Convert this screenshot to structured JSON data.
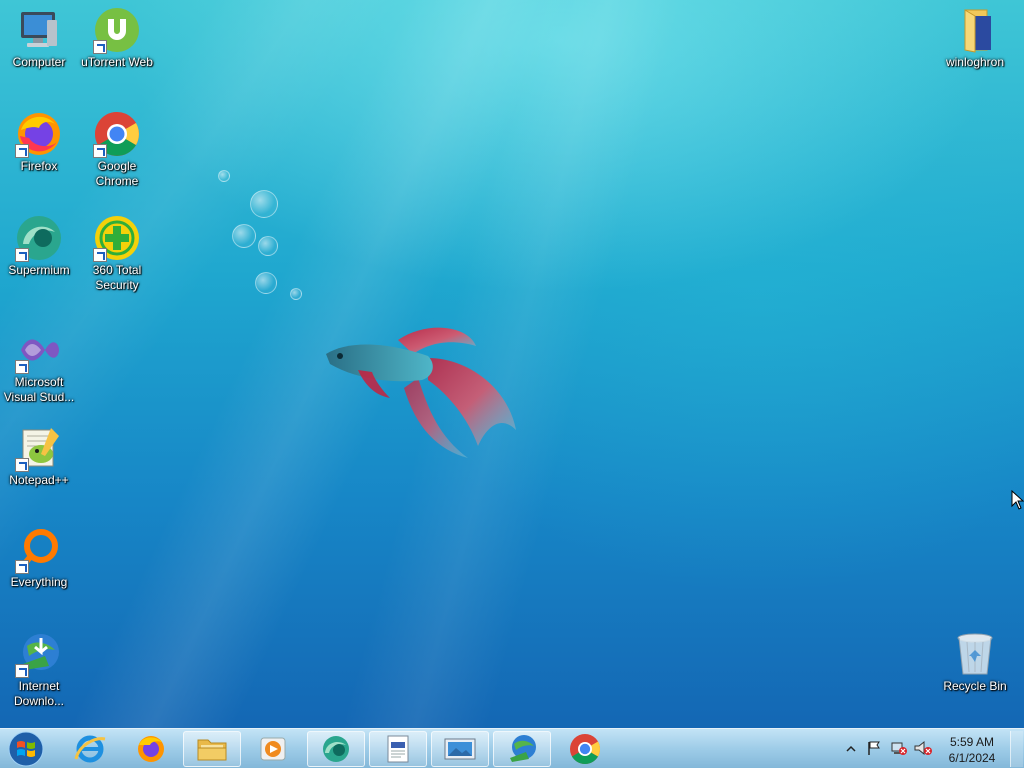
{
  "desktop": {
    "icons": [
      {
        "label": "Computer",
        "icon": "computer-icon"
      },
      {
        "label": "uTorrent Web",
        "icon": "utorrent-icon"
      },
      {
        "label": "Firefox",
        "icon": "firefox-icon"
      },
      {
        "label": "Google Chrome",
        "icon": "chrome-icon"
      },
      {
        "label": "Supermium",
        "icon": "supermium-icon"
      },
      {
        "label": "360 Total Security",
        "icon": "360-security-icon"
      },
      {
        "label": "Microsoft Visual Stud...",
        "icon": "visual-studio-icon"
      },
      {
        "label": "Notepad++",
        "icon": "notepadpp-icon"
      },
      {
        "label": "Everything",
        "icon": "everything-icon"
      },
      {
        "label": "Internet Downlo...",
        "icon": "idm-icon"
      },
      {
        "label": "winloghron",
        "icon": "folder-icon"
      },
      {
        "label": "Recycle Bin",
        "icon": "recycle-bin-icon"
      }
    ]
  },
  "taskbar": {
    "start": "windows-start-icon",
    "items": [
      {
        "name": "internet-explorer",
        "icon": "ie-icon"
      },
      {
        "name": "firefox",
        "icon": "firefox-icon"
      },
      {
        "name": "file-explorer",
        "icon": "folder-icon"
      },
      {
        "name": "media-player",
        "icon": "media-player-icon"
      },
      {
        "name": "supermium",
        "icon": "supermium-icon"
      },
      {
        "name": "document-viewer",
        "icon": "document-icon"
      },
      {
        "name": "image-viewer",
        "icon": "picture-icon"
      },
      {
        "name": "internet-download-manager",
        "icon": "idm-icon"
      },
      {
        "name": "google-chrome",
        "icon": "chrome-icon"
      }
    ],
    "tray": {
      "time": "5:59 AM",
      "date": "6/1/2024",
      "icons": [
        "show-hidden-icons-icon",
        "action-center-flag-icon",
        "network-icon",
        "volume-muted-icon"
      ]
    }
  }
}
